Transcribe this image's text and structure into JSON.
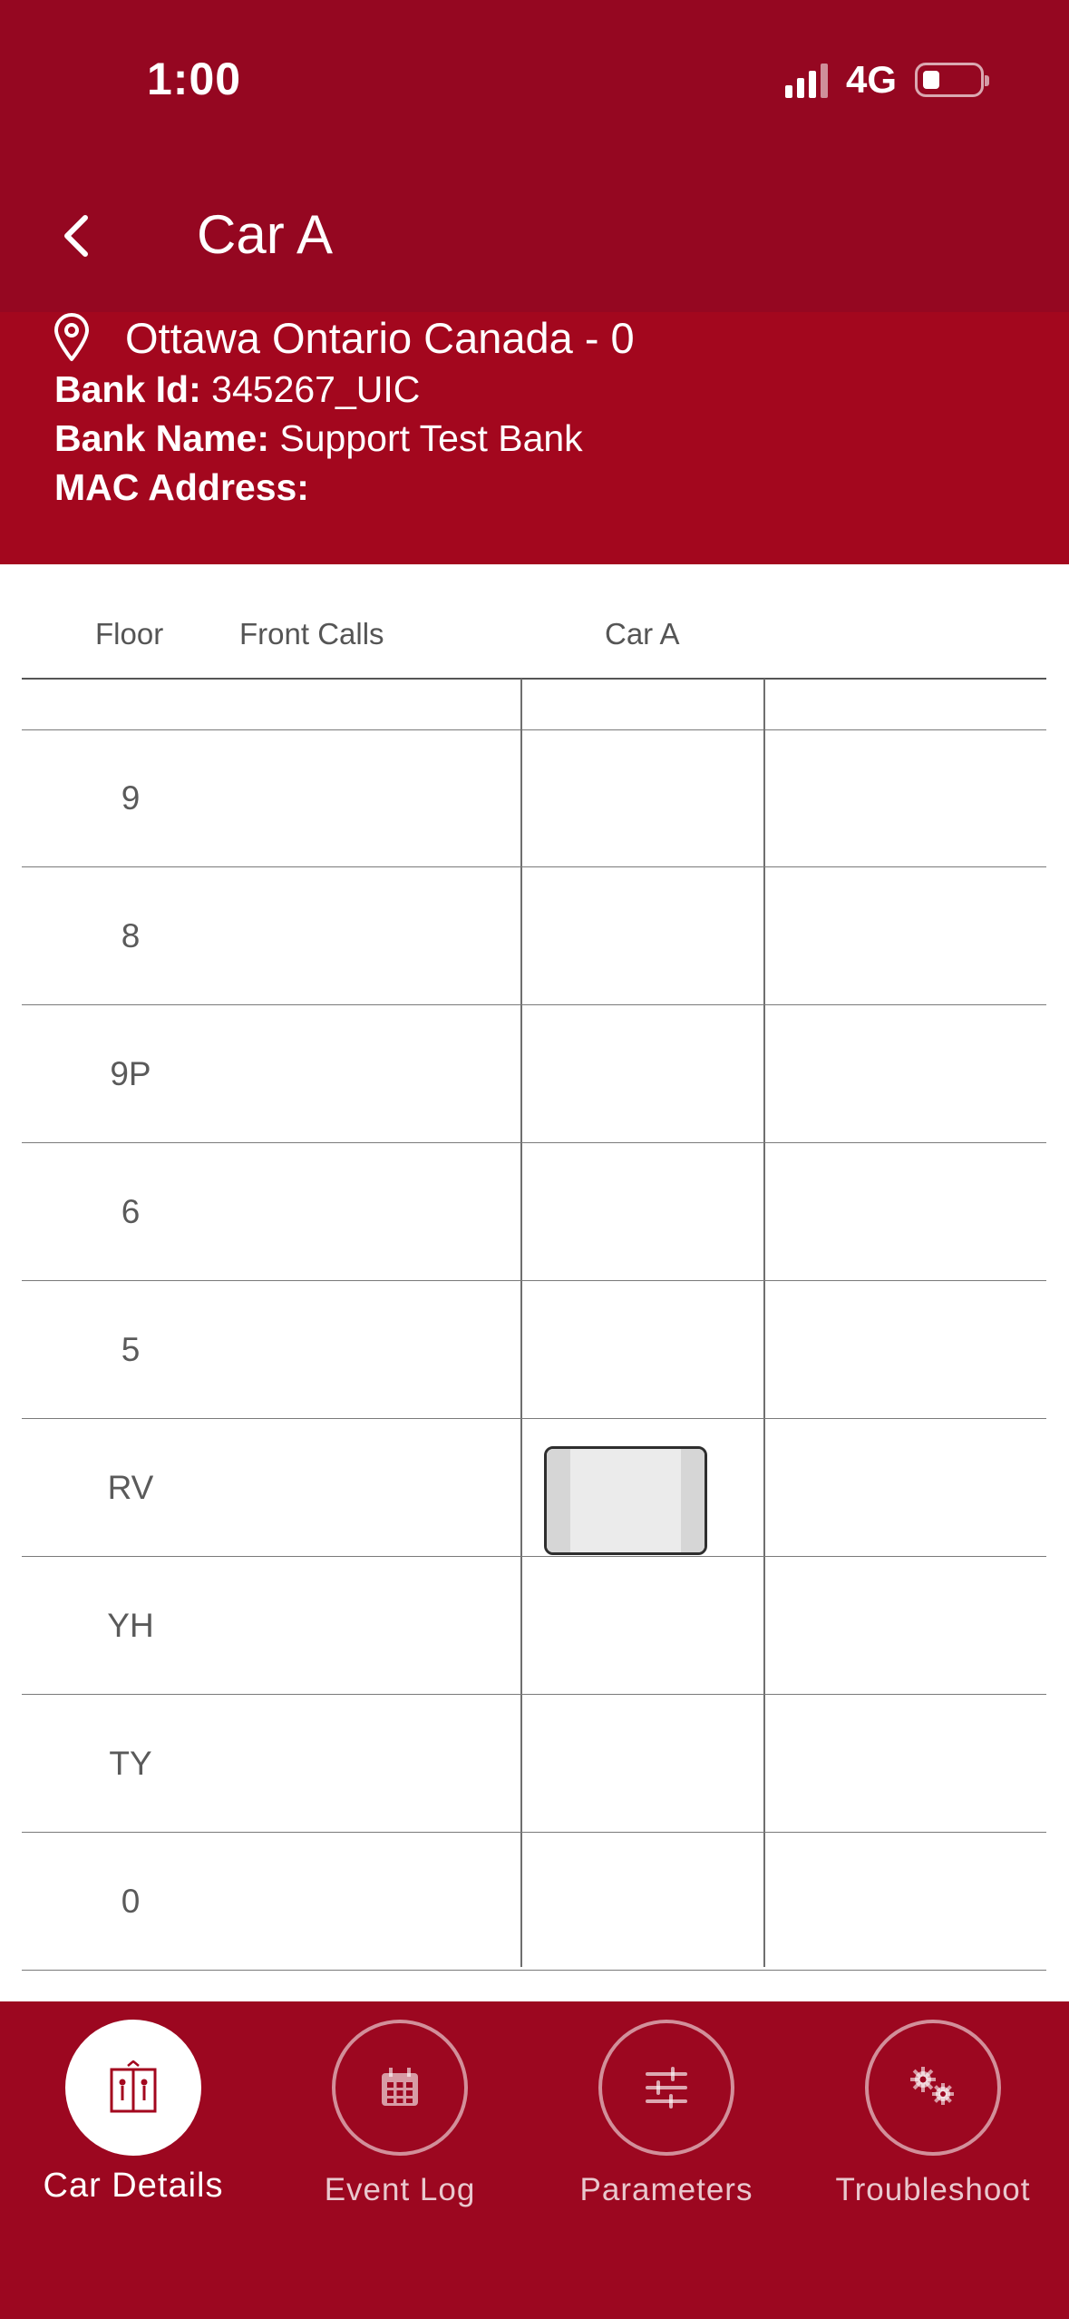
{
  "status_bar": {
    "time": "1:00",
    "network": "4G"
  },
  "header": {
    "title": "Car A"
  },
  "info": {
    "location": "Ottawa Ontario Canada - 0",
    "bank_id_label": "Bank Id:",
    "bank_id": "345267_UIC",
    "bank_name_label": "Bank Name:",
    "bank_name": "Support Test Bank",
    "mac_label": "MAC Address:",
    "mac": ""
  },
  "table": {
    "headers": {
      "floor": "Floor",
      "front_calls": "Front Calls",
      "car": "Car A"
    },
    "floors": [
      "9",
      "8",
      "9P",
      "6",
      "5",
      "RV",
      "YH",
      "TY",
      "0"
    ],
    "car_position_floor": "RV"
  },
  "tabs": [
    {
      "label": "Car Details",
      "icon": "elevator-icon",
      "active": true
    },
    {
      "label": "Event Log",
      "icon": "calendar-icon",
      "active": false
    },
    {
      "label": "Parameters",
      "icon": "sliders-icon",
      "active": false
    },
    {
      "label": "Troubleshoot",
      "icon": "gears-icon",
      "active": false
    }
  ],
  "colors": {
    "brand": "#950721",
    "band": "#a3071e",
    "tabbar": "#9c0720"
  }
}
